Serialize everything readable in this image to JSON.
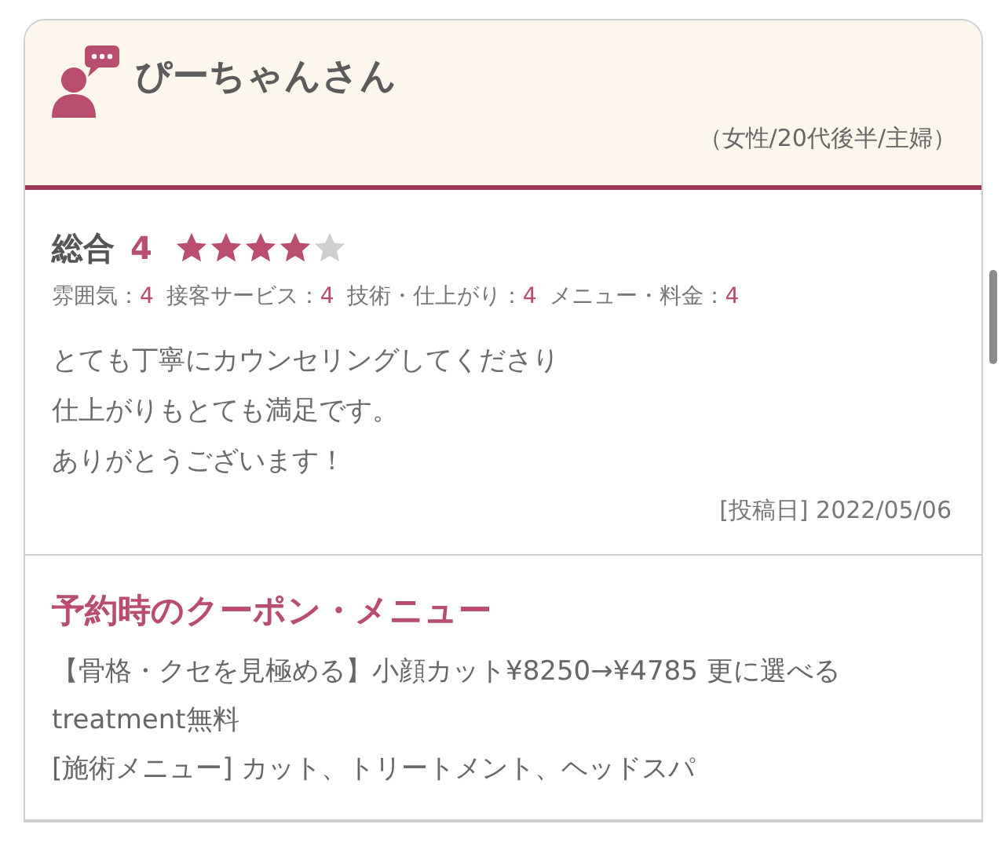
{
  "reviewer": {
    "name": "ぴーちゃんさん",
    "profile": "（女性/20代後半/主婦）"
  },
  "overall": {
    "label": "総合",
    "score": "4",
    "stars": 4
  },
  "sub_ratings": [
    {
      "label": "雰囲気：",
      "value": "4"
    },
    {
      "label": "接客サービス：",
      "value": "4"
    },
    {
      "label": "技術・仕上がり：",
      "value": "4"
    },
    {
      "label": "メニュー・料金：",
      "value": "4"
    }
  ],
  "comment": [
    "とても丁寧にカウンセリングしてくださり",
    "仕上がりもとても満足です。",
    "ありがとうございます！"
  ],
  "posted": "[投稿日] 2022/05/06",
  "coupon": {
    "title": "予約時のクーポン・メニュー",
    "description": "【骨格・クセを見極める】小顔カット¥8250→¥4785 更に選べるtreatment無料",
    "menu": "[施術メニュー] カット、トリートメント、ヘッドスパ"
  }
}
